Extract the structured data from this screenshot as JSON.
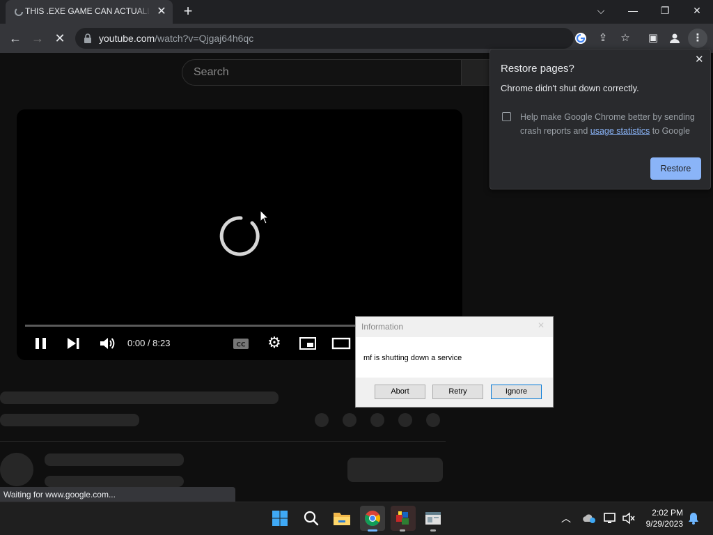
{
  "browser": {
    "tab_title": "THIS .EXE GAME CAN ACTUALLY",
    "url_host": "youtube.com",
    "url_path": "/watch?v=Qjgaj64h6qc"
  },
  "youtube": {
    "search_placeholder": "Search",
    "time": "0:00 / 8:23"
  },
  "restore": {
    "title": "Restore pages?",
    "subtitle": "Chrome didn't shut down correctly.",
    "check_text_1": "Help make Google Chrome better by sending crash reports and ",
    "check_link": "usage statistics",
    "check_text_2": " to Google",
    "button": "Restore"
  },
  "dialog": {
    "title": "Information",
    "message": "mf is shutting down a service",
    "buttons": [
      "Abort",
      "Retry",
      "Ignore"
    ]
  },
  "status_bar": "Waiting for www.google.com...",
  "taskbar": {
    "time": "2:02 PM",
    "date": "9/29/2023"
  },
  "colors": {
    "accent": "#8ab4f8",
    "page_bg": "#0f0f0f",
    "chrome_frame": "#202124"
  }
}
